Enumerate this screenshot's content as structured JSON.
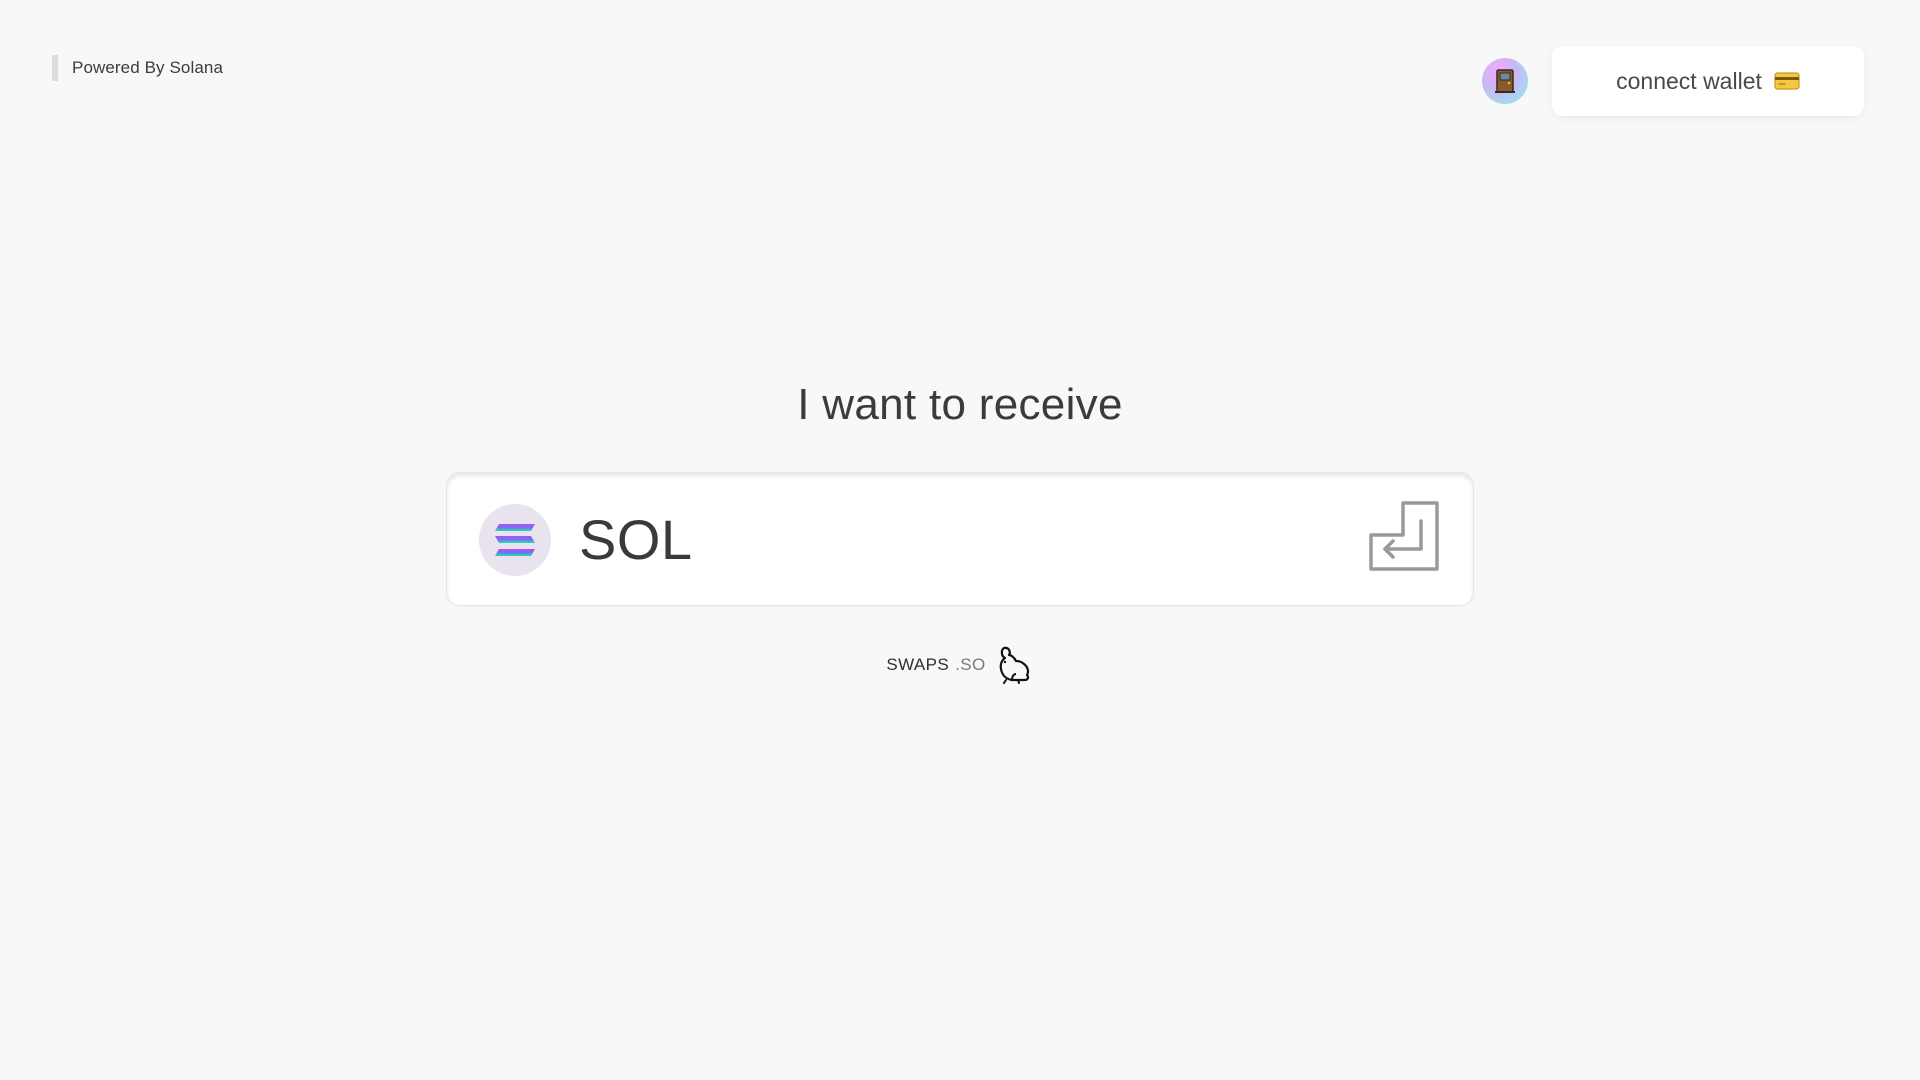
{
  "header": {
    "powered_by": "Powered By Solana",
    "avatar_icon": "door-emoji-icon",
    "connect_wallet_label": "connect wallet",
    "wallet_icon": "credit-card-icon"
  },
  "main": {
    "heading": "I want to receive",
    "token": {
      "symbol": "SOL",
      "logo_icon": "solana-logo-icon",
      "action_icon": "enter-return-icon"
    }
  },
  "footer": {
    "brand_name": "SWAPS",
    "brand_tld": ".SO",
    "mascot_icon": "rabbit-icon"
  },
  "colors": {
    "background": "#f8f8f8",
    "card": "#ffffff",
    "text": "#3a3a3a",
    "solana_purple": "#9945ff",
    "solana_green": "#14f195"
  }
}
